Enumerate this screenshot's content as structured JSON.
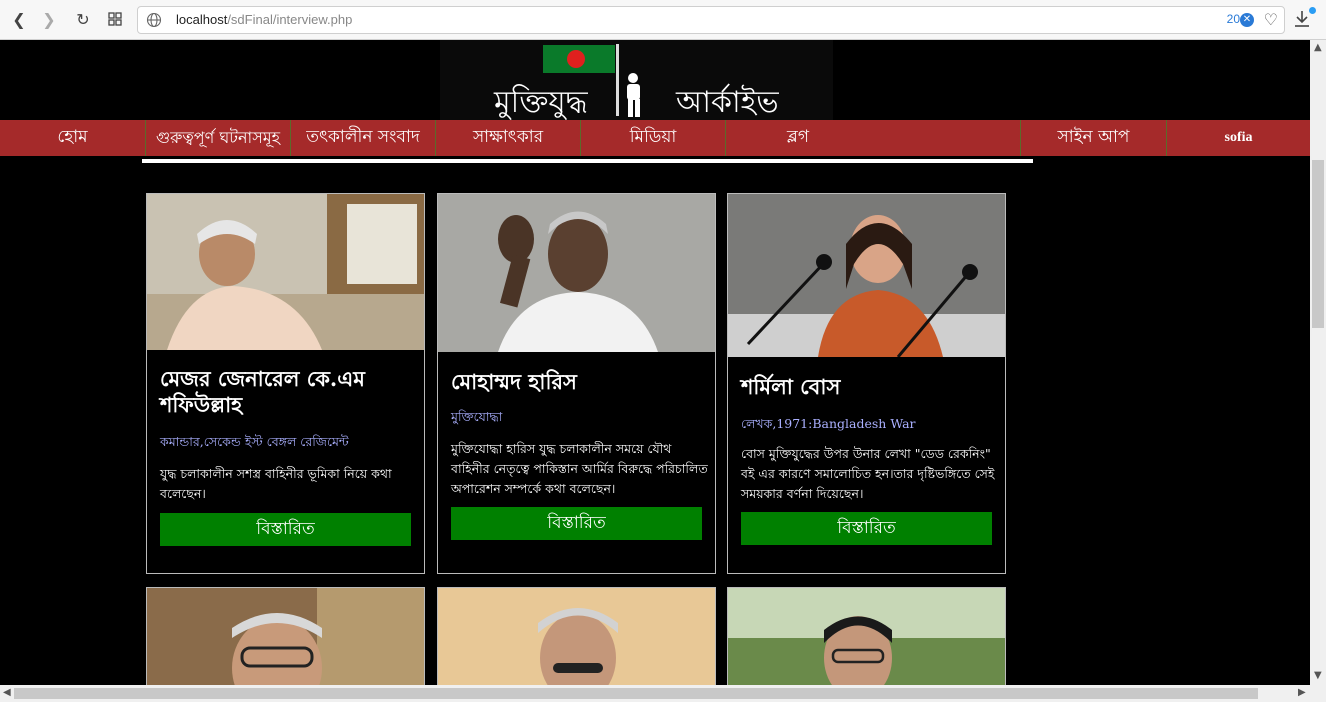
{
  "browser": {
    "url_host": "localhost",
    "url_path": "/sdFinal/interview.php",
    "tracker_count": "20"
  },
  "logo": {
    "text_left": "মুক্তিযুদ্ধ",
    "text_right": "আর্কাইভ"
  },
  "menu": [
    {
      "label": "হোম"
    },
    {
      "label": "গুরুত্বপূর্ণ ঘটনাসমূহ"
    },
    {
      "label": "তৎকালীন সংবাদ"
    },
    {
      "label": "সাক্ষাৎকার"
    },
    {
      "label": "মিডিয়া"
    },
    {
      "label": "ব্লগ"
    },
    {
      "label": "সাইন আপ"
    },
    {
      "label": "sofia"
    }
  ],
  "cards": [
    {
      "name": "মেজর জেনারেল কে.এম শফিউল্লাহ",
      "role": "কমান্ডার,সেকেন্ড ইস্ট বেঙ্গল রেজিমেন্ট",
      "desc": "যুদ্ধ চলাকালীন সশস্ত্র বাহিনীর ভূমিকা নিয়ে কথা বলেছেন।",
      "button": "বিস্তারিত"
    },
    {
      "name": "মোহাম্মদ হারিস",
      "role": "মুক্তিযোদ্ধা",
      "desc": "মুক্তিযোদ্ধা হারিস যুদ্ধ চলাকালীন সময়ে যৌথ বাহিনীর নেতৃত্বে পাকিস্তান আর্মির বিরুদ্ধে পরিচালিত অপারেশন সম্পর্কে কথা বলেছেন।",
      "button": "বিস্তারিত"
    },
    {
      "name": "শর্মিলা বোস",
      "role": "লেখক,1971:Bangladesh War",
      "desc": "বোস মুক্তিযুদ্ধের উপর উনার লেখা \"ডেড রেকনিং\" বই এর কারণে সমালোচিত হন।তার দৃষ্টিভঙ্গিতে সেই সময়কার বর্ণনা দিয়েছেন।",
      "button": "বিস্তারিত"
    }
  ]
}
